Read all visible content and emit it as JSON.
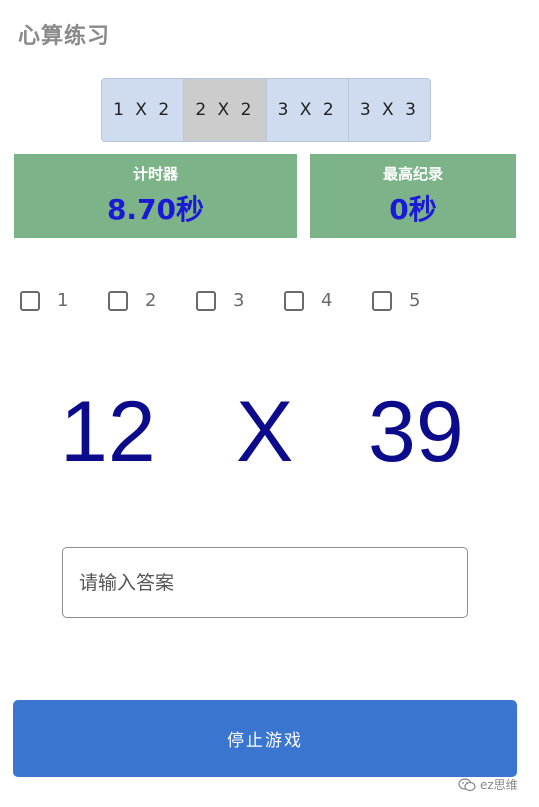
{
  "header": {
    "title": "心算练习"
  },
  "modes": [
    {
      "label": "1 X 2",
      "active": false
    },
    {
      "label": "2 X 2",
      "active": true
    },
    {
      "label": "3 X 2",
      "active": false
    },
    {
      "label": "3 X 3",
      "active": false
    }
  ],
  "stats": {
    "timer": {
      "label": "计时器",
      "value": "8.70秒"
    },
    "record": {
      "label": "最高纪录",
      "value": "0秒"
    }
  },
  "checkboxes": [
    {
      "label": "1",
      "checked": false
    },
    {
      "label": "2",
      "checked": false
    },
    {
      "label": "3",
      "checked": false
    },
    {
      "label": "4",
      "checked": false
    },
    {
      "label": "5",
      "checked": false
    }
  ],
  "problem": {
    "a": "12",
    "operator": "X",
    "b": "39"
  },
  "answer": {
    "placeholder": "请输入答案",
    "value": ""
  },
  "actions": {
    "stop_label": "停止游戏"
  },
  "watermark": {
    "text": "ez思维",
    "icon": "wechat-icon"
  },
  "colors": {
    "stat_bg": "#7db389",
    "stat_value": "#1a1ad6",
    "problem_text": "#0b0b8c",
    "primary_button": "#3a76cf",
    "mode_bg": "#cfdbee",
    "mode_active_bg": "#cccccc"
  }
}
